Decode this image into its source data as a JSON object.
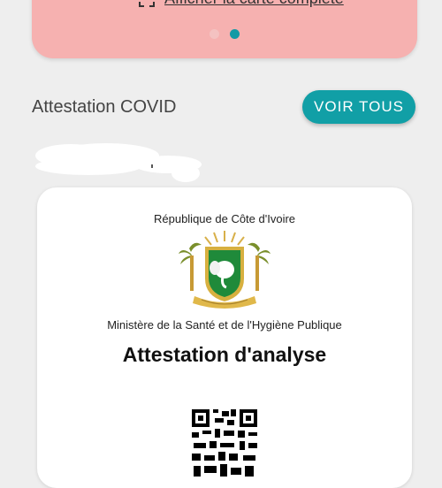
{
  "top_card": {
    "link_label": "Afficher la carte complète",
    "link_icon": "expand-icon",
    "pagination": {
      "total": 2,
      "active": 2
    }
  },
  "covid_section": {
    "title": "Attestation COVID",
    "see_all_label": "VOIR TOUS"
  },
  "certificate": {
    "country": "République de Côte d'Ivoire",
    "ministry": "Ministère de la Santé et de l'Hygiène Publique",
    "title": "Attestation d'analyse",
    "emblem_icon": "coat-of-arms-icon",
    "qr_icon": "qr-code-icon"
  },
  "colors": {
    "banner": "#f6b1b0",
    "accent": "#119fa6",
    "background": "#eeeeee",
    "card": "#ffffff"
  }
}
